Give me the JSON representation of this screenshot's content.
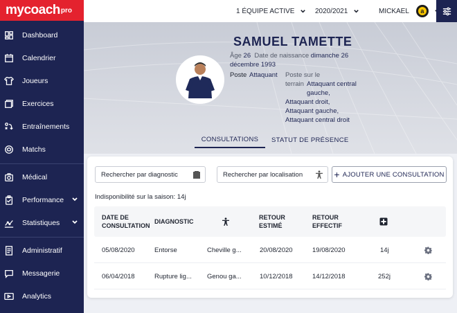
{
  "app": {
    "brand": "mycoach",
    "brand_suffix": "pro"
  },
  "sidebar": {
    "items": [
      {
        "label": "Dashboard",
        "icon": "dashboard-icon"
      },
      {
        "label": "Calendrier",
        "icon": "calendar-icon"
      },
      {
        "label": "Joueurs",
        "icon": "players-icon"
      },
      {
        "label": "Exercices",
        "icon": "exercises-icon"
      },
      {
        "label": "Entraînements",
        "icon": "trainings-icon"
      },
      {
        "label": "Matchs",
        "icon": "ball-icon"
      },
      {
        "label": "Médical",
        "icon": "medical-icon"
      },
      {
        "label": "Performance",
        "icon": "clipboard-icon"
      },
      {
        "label": "Statistiques",
        "icon": "stats-icon"
      },
      {
        "label": "Administratif",
        "icon": "admin-icon"
      },
      {
        "label": "Messagerie",
        "icon": "chat-icon"
      },
      {
        "label": "Analytics",
        "icon": "play-icon"
      }
    ]
  },
  "topbar": {
    "team": "1 ÉQUIPE ACTIVE",
    "season": "2020/2021",
    "user": "MICKAEL",
    "avatar_letter": "a"
  },
  "player": {
    "name": "SAMUEL TAMETTE",
    "age_label": "Âge",
    "age": "26",
    "birth_label": "Date de naissance",
    "birth": "dimanche 26 décembre 1993",
    "position_label": "Poste",
    "position": "Attaquant",
    "field_label": "Poste sur le terrain",
    "field_positions": [
      "Attaquant central gauche,",
      "Attaquant droit,",
      "Attaquant gauche,",
      "Attaquant central droit"
    ]
  },
  "tabs": {
    "consultations": "CONSULTATIONS",
    "presence": "STATUT DE PRÉSENCE"
  },
  "filters": {
    "diagnostic": "Rechercher par diagnostic",
    "location": "Rechercher par localisation",
    "add": "AJOUTER UNE CONSULTATION"
  },
  "unavailability": "Indisponibilité sur la saison: 14j",
  "table": {
    "headers": {
      "date": "DATE DE CONSULTATION",
      "diagnostic": "DIAGNOSTIC",
      "expected": "RETOUR ESTIMÉ",
      "actual": "RETOUR EFFECTIF"
    },
    "rows": [
      {
        "date": "05/08/2020",
        "diagnostic": "Entorse",
        "location": "Cheville g...",
        "expected": "20/08/2020",
        "actual": "19/08/2020",
        "days": "14j"
      },
      {
        "date": "06/04/2018",
        "diagnostic": "Rupture lig...",
        "location": "Genou ga...",
        "expected": "10/12/2018",
        "actual": "14/12/2018",
        "days": "252j"
      }
    ]
  }
}
